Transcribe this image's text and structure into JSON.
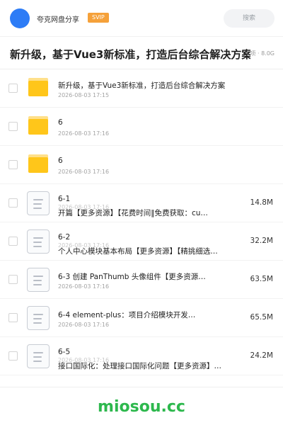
{
  "header": {
    "user_name": "夸克网盘分享",
    "badge": "SVIP",
    "search_placeholder": "搜索"
  },
  "folder": {
    "title": "新升级，基于Vue3新标准，打造后台综合解决方案",
    "meta": "项 · 8.0G"
  },
  "files": [
    {
      "type": "folder",
      "name": "新升级，基于Vue3新标准，打造后台综合解决方案",
      "date": "2026-08-03 17:15",
      "size": ""
    },
    {
      "type": "folder",
      "name": "6",
      "date": "2026-08-03 17:16",
      "size": ""
    },
    {
      "type": "folder",
      "name": "6",
      "date": "2026-08-03 17:16",
      "size": ""
    },
    {
      "type": "doc",
      "name": "6-1",
      "name2": "开篇【更多资源】【花费时间‖免费获取：cu…",
      "date": "2026-08-03 17:16",
      "size": "14.8M"
    },
    {
      "type": "doc",
      "name": "6-2",
      "name2": "个人中心模块基本布局【更多资源】【精挑细选…",
      "date": "2026-08-03 17:16",
      "size": "32.2M"
    },
    {
      "type": "doc",
      "name": "6-3 创建 PanThumb 头像组件【更多资源…",
      "name2": "",
      "date": "2026-08-03 17:16",
      "size": "63.5M"
    },
    {
      "type": "doc",
      "name": "6-4 element-plus：项目介绍模块开发…",
      "name2": "",
      "date": "2026-08-03 17:16",
      "size": "65.5M"
    },
    {
      "type": "doc",
      "name": "6-5",
      "name2": "接口国际化：处理接口国际化问题【更多资源】…",
      "date": "2026-08-03 17:16",
      "size": "24.2M"
    }
  ],
  "watermark": "miosou.cc",
  "colors": {
    "accent": "#2d7cf6",
    "svip": "#f5a13a",
    "folder": "#ffc61a",
    "watermark": "#2db84d"
  }
}
